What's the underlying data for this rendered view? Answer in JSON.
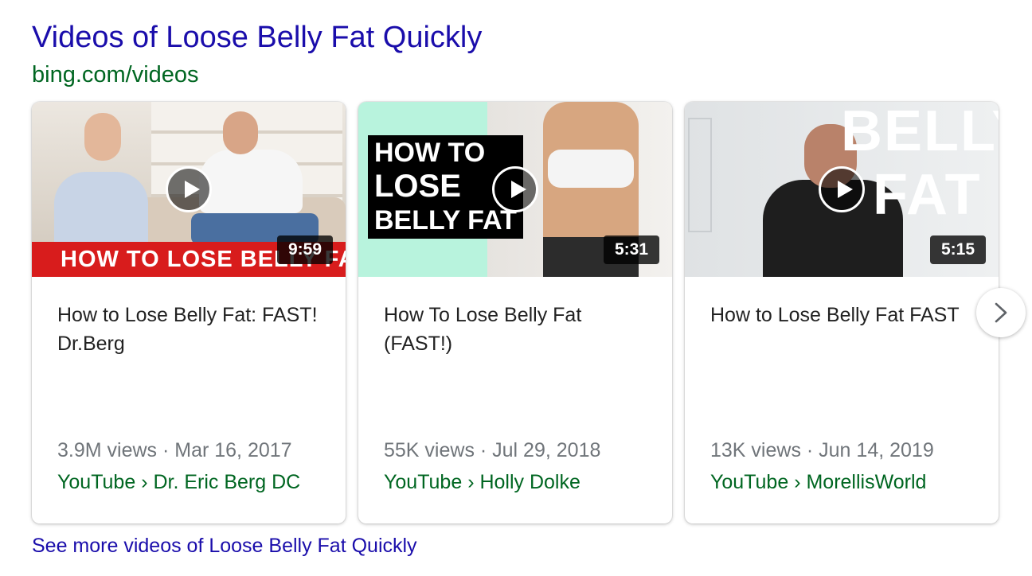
{
  "header": {
    "title": "Videos of Loose Belly Fat Quickly",
    "source": "bing.com/videos"
  },
  "colors": {
    "link": "#1a0dab",
    "source_green": "#006621",
    "meta_gray": "#70757a",
    "banner_red": "#d81c1c",
    "mint": "#b8f3dd"
  },
  "videos": [
    {
      "duration": "9:59",
      "thumbnail_text": "HOW TO LOSE BELLY FAT",
      "title": "How to Lose Belly Fat: FAST! Dr.Berg",
      "meta": "3.9M views · Mar 16, 2017",
      "channel": "YouTube › Dr. Eric Berg DC"
    },
    {
      "duration": "5:31",
      "thumbnail_text": [
        "HOW TO",
        "LOSE",
        "BELLY FAT"
      ],
      "title": "How To Lose Belly Fat (FAST!)",
      "meta": "55K views · Jul 29, 2018",
      "channel": "YouTube › Holly Dolke"
    },
    {
      "duration": "5:15",
      "thumbnail_text": [
        "BELLY",
        "FAT"
      ],
      "title": "How to Lose Belly Fat FAST",
      "meta": "13K views · Jun 14, 2019",
      "channel": "YouTube › MorellisWorld"
    }
  ],
  "icons": {
    "play": "play-icon",
    "next": "chevron-right-icon"
  },
  "see_more": "See more videos of Loose Belly Fat Quickly"
}
